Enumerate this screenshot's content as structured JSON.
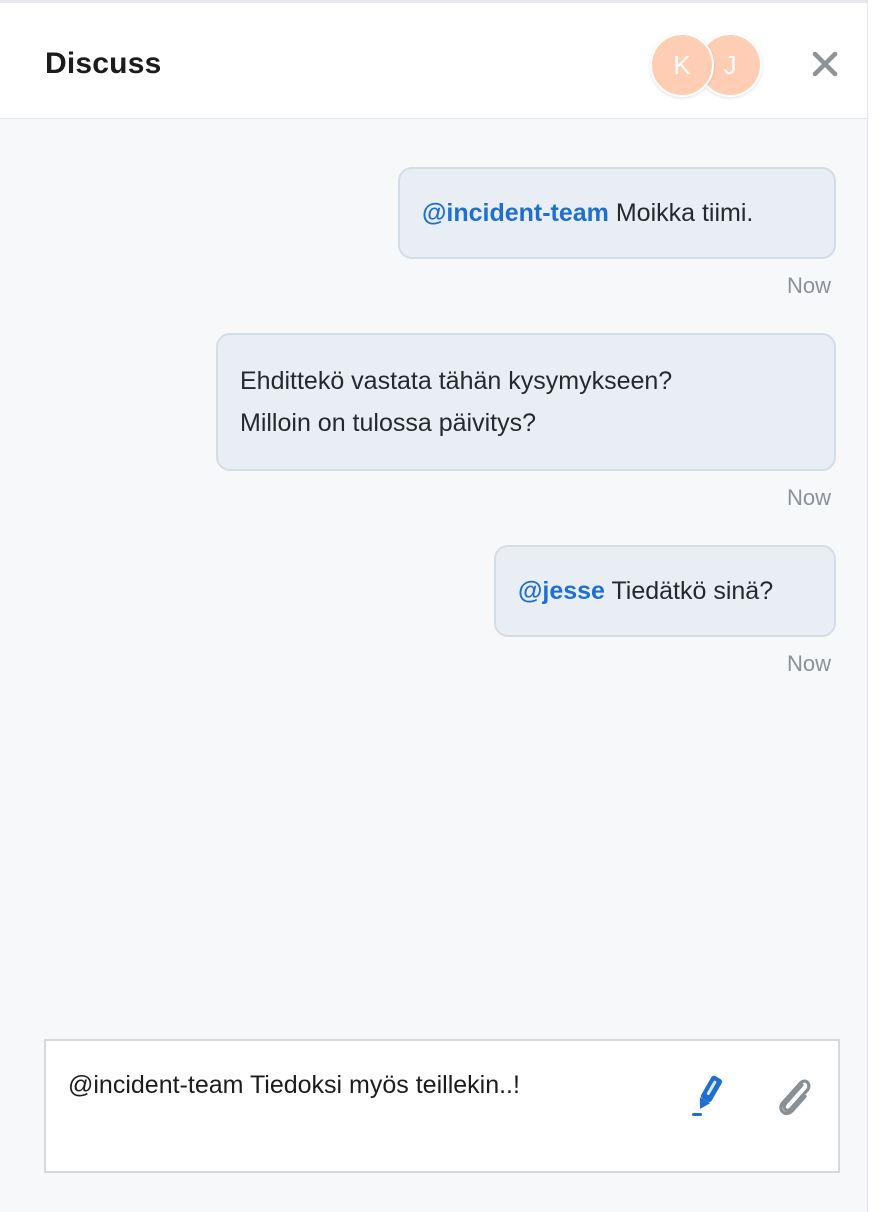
{
  "header": {
    "title": "Discuss",
    "participants": [
      {
        "initial": "K",
        "color": "#ffcdb3"
      },
      {
        "initial": "J",
        "color": "#ffcdb3"
      }
    ],
    "close_icon": "close-icon"
  },
  "messages": [
    {
      "mention": "@incident-team",
      "text": " Moikka tiimi.",
      "time": "Now"
    },
    {
      "line1": "Ehdittekö vastata tähän kysymykseen?",
      "line2": "Milloin on tulossa päivitys?",
      "time": "Now"
    },
    {
      "mention": "@jesse",
      "text": " Tiedätkö sinä?",
      "time": "Now"
    }
  ],
  "composer": {
    "value": "@incident-team Tiedoksi myös teillekin..!",
    "pen_icon": "pen-icon",
    "attach_icon": "paperclip-icon"
  },
  "colors": {
    "mention": "#1f6fd1",
    "bubble_bg": "#e8eef3",
    "avatar": "#ffcdb3",
    "pen": "#1f6fd1"
  }
}
